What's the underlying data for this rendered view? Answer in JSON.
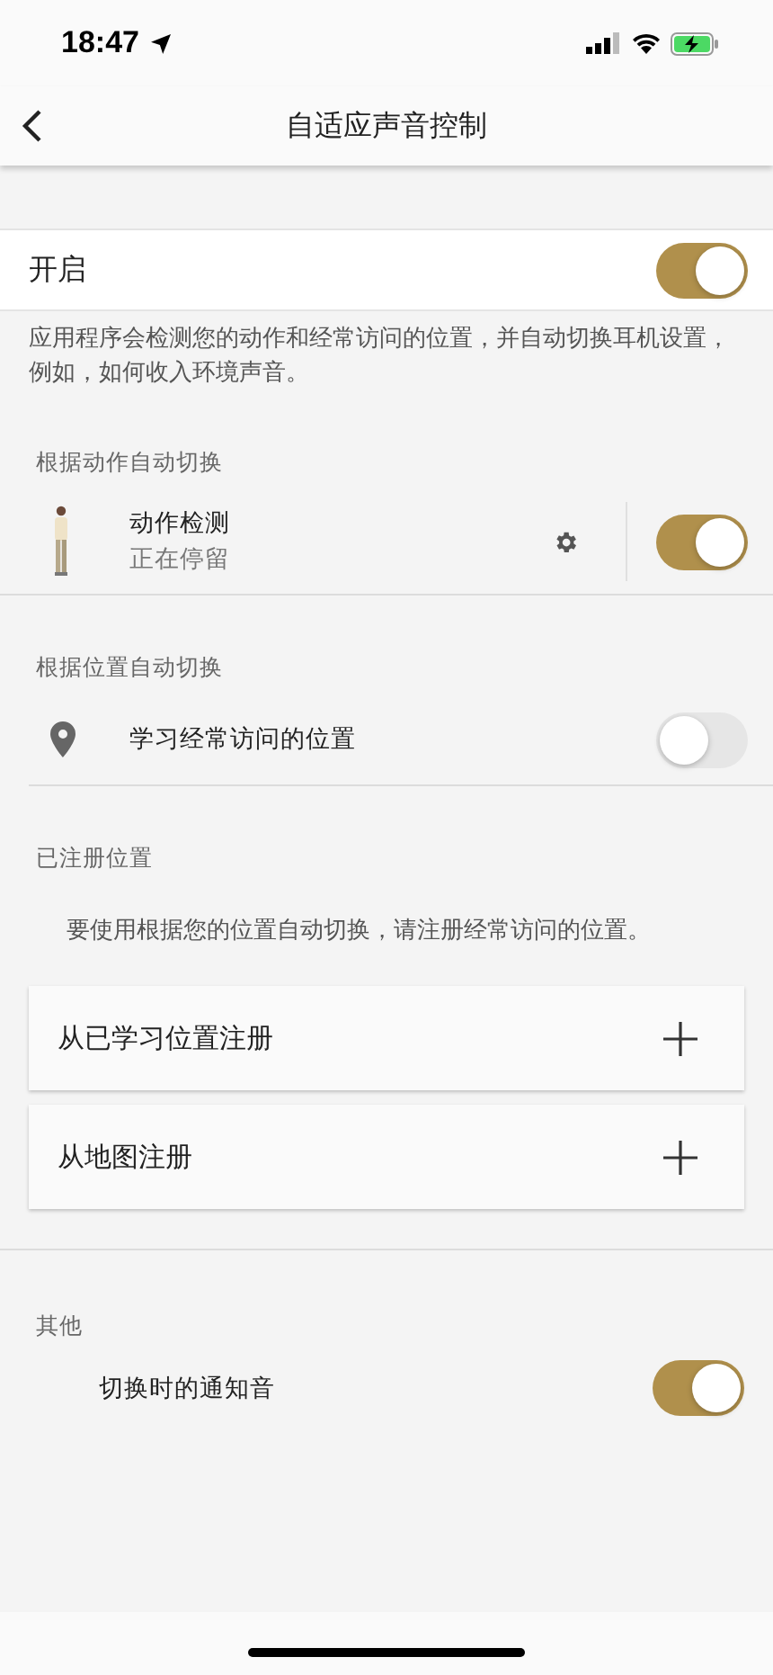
{
  "status_bar": {
    "time": "18:47"
  },
  "nav": {
    "title": "自适应声音控制"
  },
  "enable": {
    "label": "开启",
    "on": true
  },
  "description": "应用程序会检测您的动作和经常访问的位置，并自动切换耳机设置，例如，如何收入环境声音。",
  "motion": {
    "header": "根据动作自动切换",
    "title": "动作检测",
    "subtitle": "正在停留",
    "on": true
  },
  "location": {
    "header": "根据位置自动切换",
    "label": "学习经常访问的位置",
    "on": false
  },
  "registered": {
    "header": "已注册位置",
    "note": "要使用根据您的位置自动切换，请注册经常访问的位置。",
    "actions": [
      "从已学习位置注册",
      "从地图注册"
    ]
  },
  "other": {
    "header": "其他",
    "label": "切换时的通知音",
    "on": true
  }
}
